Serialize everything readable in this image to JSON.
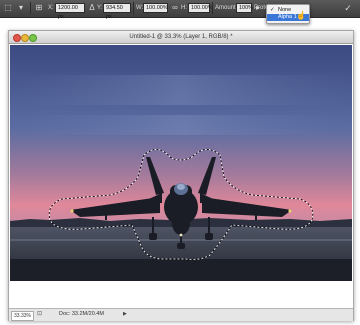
{
  "options_bar": {
    "x_label": "X:",
    "x_value": "1200.00 px",
    "y_label": "Y:",
    "y_value": "934.50 px",
    "w_label": "W:",
    "w_value": "100.00%",
    "h_label": "H:",
    "h_value": "100.00%",
    "angle_value": "0",
    "rotate_label": "Amount",
    "rotate_value": "100%",
    "protect_label": "Protect:",
    "protect_menu": {
      "options": [
        "None",
        "Alpha 1"
      ],
      "checked": "None",
      "highlighted": "Alpha 1"
    }
  },
  "document": {
    "title": "Untitled-1 @ 33.3% (Layer 1, RGB/8) *",
    "status_zoom": "33.33%",
    "status_doc": "Doc: 33.2M/20.4M"
  },
  "icons": {
    "menu_check": "✓",
    "status_icon": "⊡",
    "status_arrow": "▶",
    "hand": "☝"
  }
}
